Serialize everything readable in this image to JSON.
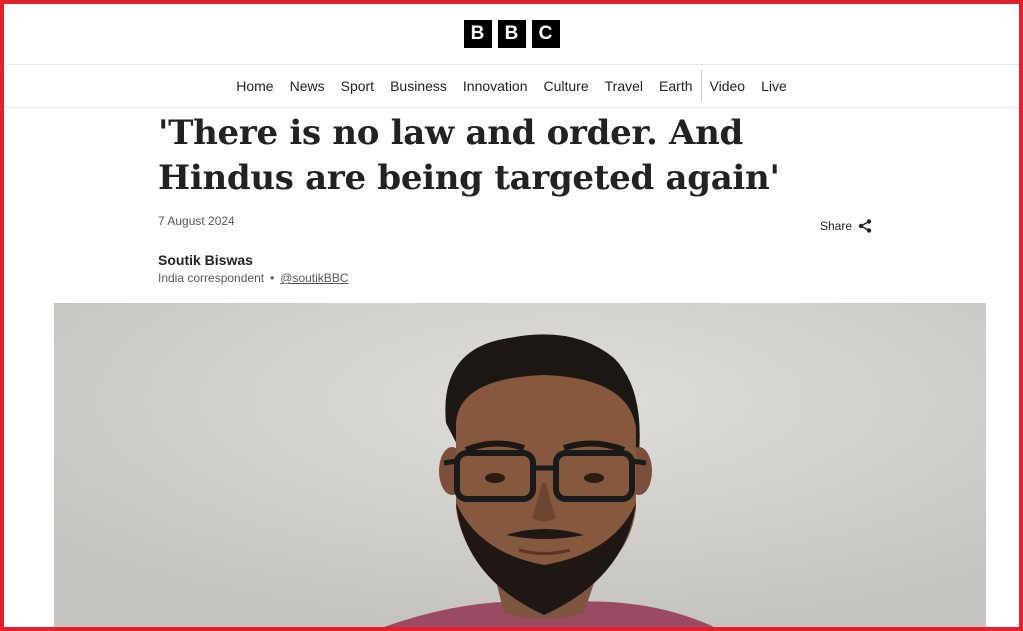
{
  "brand": {
    "logo_letters": [
      "B",
      "B",
      "C"
    ]
  },
  "nav": {
    "items": [
      "Home",
      "News",
      "Sport",
      "Business",
      "Innovation",
      "Culture",
      "Travel",
      "Earth",
      "Video",
      "Live"
    ]
  },
  "article": {
    "headline": "'There is no law and order. And Hindus are being targeted again'",
    "date": "7 August 2024",
    "share_label": "Share",
    "author": {
      "name": "Soutik Biswas",
      "role": "India correspondent",
      "separator": "•",
      "handle": "@soutikBBC"
    }
  },
  "colors": {
    "frame": "#e3202c",
    "logo_bg": "#000000",
    "text": "#202224",
    "muted": "#545658"
  }
}
